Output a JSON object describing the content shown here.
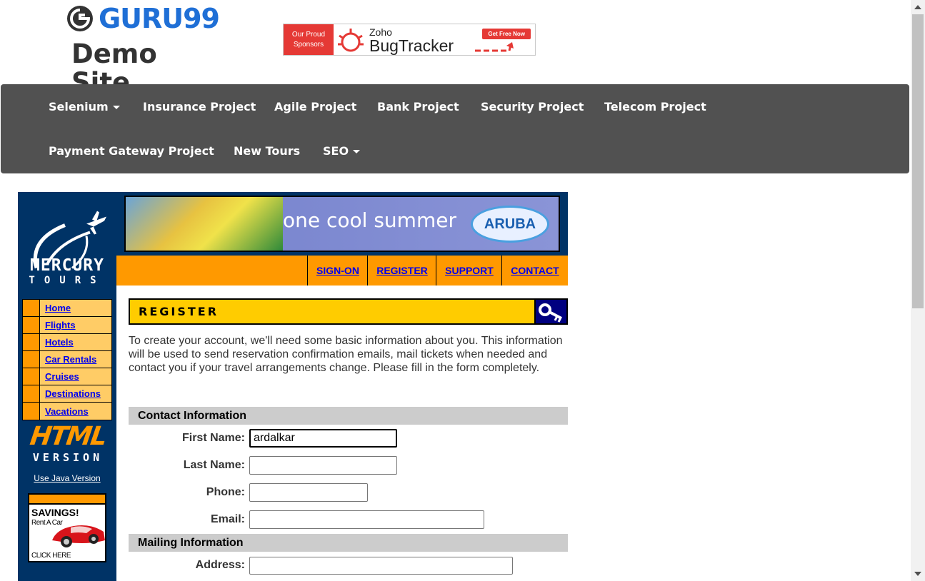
{
  "header": {
    "logo_word": "GURU99",
    "logo_subtitle": "Demo Site",
    "sponsor": {
      "left_line1": "Our Proud",
      "left_line2": "Sponsors",
      "brand_small": "Zoho",
      "brand_big": "BugTracker",
      "cta": "Get Free Now"
    }
  },
  "navbar": {
    "items": [
      {
        "label": "Selenium",
        "dropdown": true
      },
      {
        "label": "Insurance Project"
      },
      {
        "label": "Agile Project"
      },
      {
        "label": "Bank Project"
      },
      {
        "label": "Security Project"
      },
      {
        "label": "Telecom Project"
      },
      {
        "label": "Payment Gateway Project"
      },
      {
        "label": "New Tours"
      },
      {
        "label": "SEO",
        "dropdown": true
      }
    ]
  },
  "mercury": {
    "brand_line1": "MERCURY",
    "brand_line2": "TOURS",
    "side_nav": [
      "Home",
      "Flights",
      "Hotels",
      "Car Rentals",
      "Cruises",
      "Destinations",
      "Vacations"
    ],
    "html_badge_line1": "HTML",
    "html_badge_line2": "VERSION",
    "java_link": "Use Java Version",
    "ad": {
      "title": "SAVINGS!",
      "subtitle": "Rent A Car",
      "cta": "CLICK HERE"
    },
    "promo_text": "one cool summer",
    "promo_brand": "ARUBA",
    "top_nav": [
      "SIGN-ON",
      "REGISTER",
      "SUPPORT",
      "CONTACT"
    ]
  },
  "register": {
    "title": "REGISTER",
    "intro": "To create your account, we'll need some basic information about you. This information will be used to send reservation confirmation emails, mail tickets when needed and contact you if your travel arrangements change. Please fill in the form completely.",
    "contact_section": "Contact Information",
    "first_name_label": "First Name:",
    "first_name_value": "ardalkar",
    "last_name_label": "Last Name:",
    "last_name_value": "",
    "phone_label": "Phone:",
    "phone_value": "",
    "email_label": "Email:",
    "email_value": "",
    "mailing_section": "Mailing Information",
    "address_label": "Address:",
    "address_value": ""
  },
  "colors": {
    "navbar_bg": "#515151",
    "brand_blue": "#1f6fd6",
    "mercury_navy": "#003366",
    "mercury_orange": "#ff9900",
    "mercury_gold": "#ffcc00",
    "section_gray": "#cccccc"
  }
}
